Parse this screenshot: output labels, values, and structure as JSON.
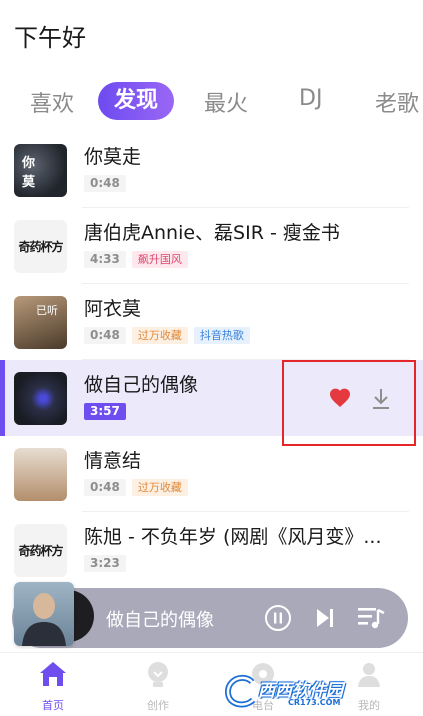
{
  "header": {
    "greeting": "下午好"
  },
  "tabs": [
    {
      "label": "喜欢",
      "active": false
    },
    {
      "label": "发现",
      "active": true
    },
    {
      "label": "最火",
      "active": false
    },
    {
      "label": "DJ",
      "active": false
    },
    {
      "label": "老歌",
      "active": false
    }
  ],
  "songs": [
    {
      "title": "你莫走",
      "duration": "0:48",
      "badges": []
    },
    {
      "title": "唐伯虎Annie、磊SIR - 瘦金书",
      "duration": "4:33",
      "badges": [
        "飙升国风"
      ]
    },
    {
      "title": "阿衣莫",
      "duration": "0:48",
      "badges": [
        "过万收藏",
        "抖音热歌"
      ],
      "cover_text": "已听"
    },
    {
      "title": "做自己的偶像",
      "duration": "3:57",
      "badges": [],
      "playing": true,
      "liked": true
    },
    {
      "title": "情意结",
      "duration": "0:48",
      "badges": [
        "过万收藏"
      ]
    },
    {
      "title": "陈旭 - 不负年岁 (网剧《风月变》...",
      "duration": "3:23",
      "badges": []
    }
  ],
  "cover_logo": "奇药杯方",
  "player": {
    "title": "做自己的偶像"
  },
  "nav": [
    {
      "label": "首页",
      "active": true,
      "icon": "home-icon"
    },
    {
      "label": "创作",
      "active": false,
      "icon": "lightbulb-icon"
    },
    {
      "label": "电台",
      "active": false,
      "icon": "radio-icon"
    },
    {
      "label": "我的",
      "active": false,
      "icon": "profile-icon"
    }
  ],
  "watermark": {
    "brand": "西西软件园",
    "url": "CR173.COM"
  },
  "colors": {
    "accent": "#6f4ef0",
    "like": "#e43a3f",
    "highlight": "#ece9fb",
    "box": "#e4252a"
  }
}
